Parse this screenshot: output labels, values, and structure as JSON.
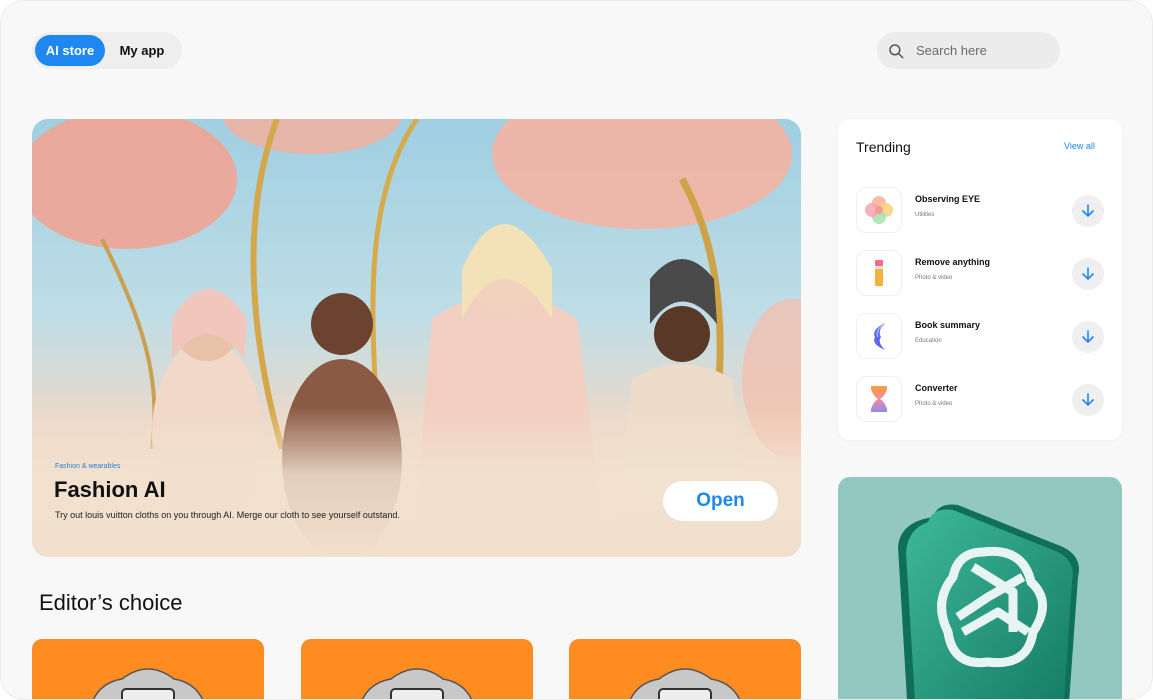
{
  "tabs": [
    {
      "label": "AI store",
      "active": true
    },
    {
      "label": "My app",
      "active": false
    }
  ],
  "search": {
    "placeholder": "Search here",
    "icon": "search-icon"
  },
  "hero": {
    "category": "Fashion & wearables",
    "title": "Fashion AI",
    "description": "Try out louis vuitton cloths on you through AI. Merge our cloth to see yourself outstand.",
    "open_label": "Open"
  },
  "editors_choice": {
    "title": "Editor’s choice",
    "card_color": "#ff8c21"
  },
  "trending": {
    "title": "Trending",
    "view_all": "View all",
    "items": [
      {
        "name": "Observing EYE",
        "category": "Utilities",
        "icon": "flower-icon"
      },
      {
        "name": "Remove anything",
        "category": "Photo & video",
        "icon": "eraser-icon"
      },
      {
        "name": "Book summary",
        "category": "Education",
        "icon": "book-icon"
      },
      {
        "name": "Converter",
        "category": "Photo & video",
        "icon": "hourglass-icon"
      }
    ]
  },
  "colors": {
    "accent": "#1e88f0",
    "promo_bg": "#93c8c2",
    "page_bg": "#f8f8f8"
  }
}
